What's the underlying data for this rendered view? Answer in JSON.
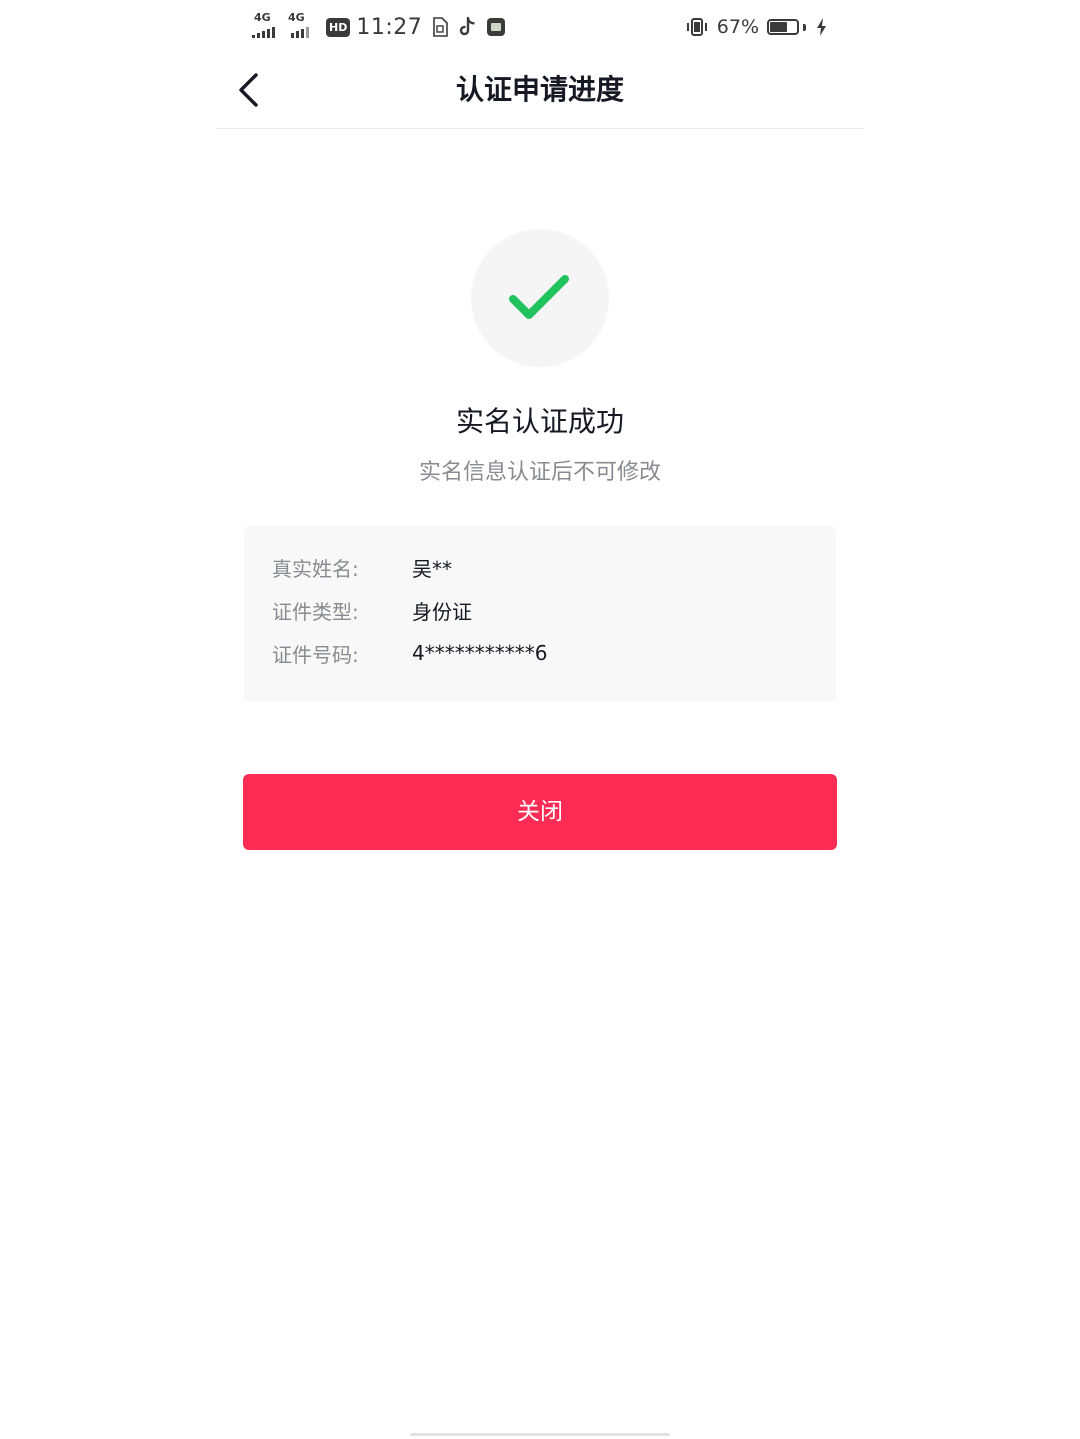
{
  "status_bar": {
    "signal_1": "4G",
    "signal_2": "4G",
    "hd_badge": "HD",
    "time": "11:27",
    "battery_percent_label": "67%",
    "battery_level": 0.67,
    "icons": [
      "signal-icon",
      "sim-icon",
      "tiktok-icon",
      "app-icon",
      "vibrate-icon",
      "battery-icon",
      "charging-icon"
    ]
  },
  "header": {
    "title": "认证申请进度",
    "back_icon": "chevron-left-icon"
  },
  "result": {
    "icon": "check-icon",
    "title": "实名认证成功",
    "subtitle": "实名信息认证后不可修改"
  },
  "info": {
    "rows": [
      {
        "label": "真实姓名:",
        "value": "吴**"
      },
      {
        "label": "证件类型:",
        "value": "身份证"
      },
      {
        "label": "证件号码:",
        "value": "4***********6"
      }
    ]
  },
  "actions": {
    "close_label": "关闭"
  },
  "colors": {
    "accent": "#fe2c55",
    "success": "#22c35e",
    "text_primary": "#161823",
    "text_secondary": "#8a8b91",
    "card_bg": "#f8f8f8"
  }
}
